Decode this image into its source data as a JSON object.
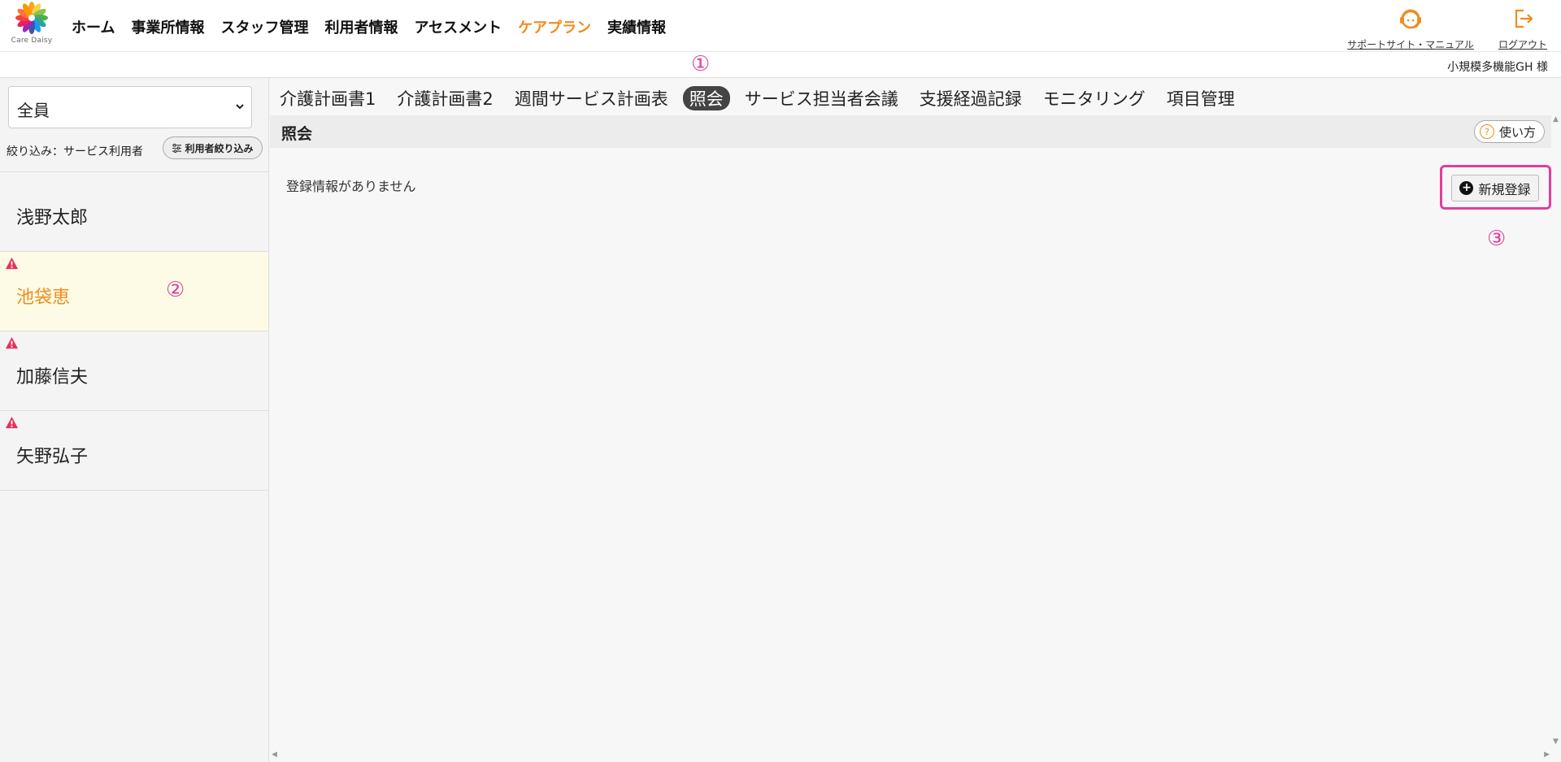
{
  "header": {
    "logo_text": "Care Daisy",
    "nav": [
      {
        "label": "ホーム",
        "active": false
      },
      {
        "label": "事業所情報",
        "active": false
      },
      {
        "label": "スタッフ管理",
        "active": false
      },
      {
        "label": "利用者情報",
        "active": false
      },
      {
        "label": "アセスメント",
        "active": false
      },
      {
        "label": "ケアプラン",
        "active": true
      },
      {
        "label": "実績情報",
        "active": false
      }
    ],
    "support_label": "サポートサイト・マニュアル",
    "logout_label": "ログアウト",
    "accent_color": "#f08c1e"
  },
  "subbar": {
    "annotation": "①",
    "facility": "小規模多機能GH 様"
  },
  "sidebar": {
    "select_value": "全員",
    "filter_label": "絞り込み：サービス利用者",
    "filter_button": "利用者絞り込み",
    "users": [
      {
        "name": "浅野太郎",
        "warning": false,
        "selected": false
      },
      {
        "name": "池袋恵",
        "warning": true,
        "selected": true
      },
      {
        "name": "加藤信夫",
        "warning": true,
        "selected": false
      },
      {
        "name": "矢野弘子",
        "warning": true,
        "selected": false
      }
    ],
    "annotation": "②"
  },
  "main": {
    "tabs": [
      {
        "label": "介護計画書1",
        "active": false
      },
      {
        "label": "介護計画書2",
        "active": false
      },
      {
        "label": "週間サービス計画表",
        "active": false
      },
      {
        "label": "照会",
        "active": true
      },
      {
        "label": "サービス担当者会議",
        "active": false
      },
      {
        "label": "支援経過記録",
        "active": false
      },
      {
        "label": "モニタリング",
        "active": false
      },
      {
        "label": "項目管理",
        "active": false
      }
    ],
    "section_title": "照会",
    "help_label": "使い方",
    "empty_message": "登録情報がありません",
    "new_button": "新規登録",
    "annotation": "③",
    "annotation_color": "#e23c9b"
  }
}
